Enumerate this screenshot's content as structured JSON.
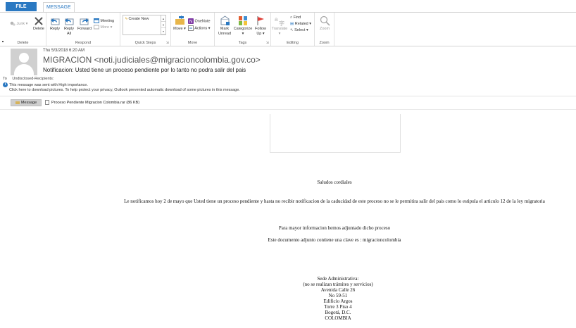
{
  "ribbon": {
    "tabs": {
      "file": "FILE",
      "message": "MESSAGE"
    },
    "delete_group": {
      "junk": "Junk",
      "delete": "Delete",
      "label": "Delete"
    },
    "respond_group": {
      "reply": "Reply",
      "reply_all_1": "Reply",
      "reply_all_2": "All",
      "forward": "Forward",
      "meeting": "Meeting",
      "more": "More",
      "label": "Respond"
    },
    "quick_steps": {
      "create_new": "Create New",
      "label": "Quick Steps"
    },
    "move_group": {
      "move": "Move",
      "onenote": "OneNote",
      "actions": "Actions",
      "label": "Move"
    },
    "tags_group": {
      "mark_unread_1": "Mark",
      "mark_unread_2": "Unread",
      "categorize": "Categorize",
      "follow_up_1": "Follow",
      "follow_up_2": "Up",
      "label": "Tags"
    },
    "editing_group": {
      "translate": "Translate",
      "find": "Find",
      "related": "Related",
      "select": "Select",
      "label": "Editing"
    },
    "zoom_group": {
      "zoom": "Zoom",
      "label": "Zoom"
    }
  },
  "header": {
    "date": "Thu 5/3/2018 6:20 AM",
    "sender": "MIGRACION <noti.judiciales@migracioncolombia.gov.co>",
    "subject": "Notificacion: Usted tiene un proceso  pendiente por lo tanto no podra salir del pais",
    "to_label": "To",
    "to_value": "Undisclosed-Recipients:",
    "importance": "This message was sent with High importance.",
    "pictures": "Click here to download pictures. To help protect your privacy, Outlook prevented automatic download of some pictures in this message.",
    "info_icon_glyph": "i"
  },
  "attachments": {
    "message_tab": "Message",
    "file": "Proceso Pendiente Migracion Colombia.rar (86 KB)"
  },
  "body": {
    "greeting": "Saludos cordiales",
    "paragraph1": "Le notificamos hoy 2 de mayo que Usted tiene un proceso pendiente y hasta no recibir notificacion de la caducidad de este proceso no se le permitira salir del pais como lo estipula el articulo 12 de la ley migratoria",
    "paragraph2": "Para mayor informacion hemos adjuntado dicho proceso",
    "paragraph3": "Este documento adjunto contiene una clave es : migracioncolombia",
    "address": [
      "Sede Administrativa:",
      "(no se realizan trámites y servicios)",
      "Avenida Calle 26",
      "No 59-51",
      "Edificio Argos",
      "Torre 3 Piso 4",
      "Bogotá, D.C.",
      "COLOMBIA"
    ]
  },
  "colors": {
    "accent": "#2b79c2",
    "ribbon_border": "#d4d4d4"
  }
}
